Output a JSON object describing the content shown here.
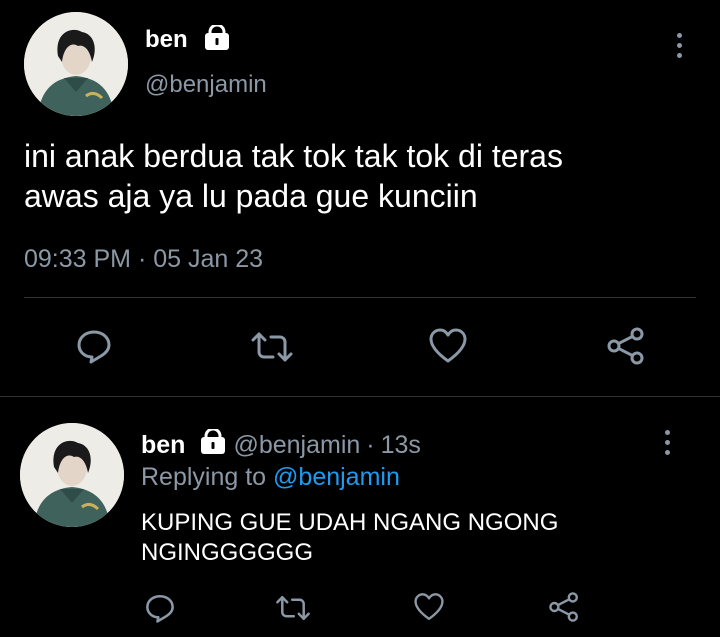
{
  "main_tweet": {
    "display_name": "ben",
    "handle": "@benjamin",
    "text_line1": "ini anak berdua tak tok tak tok di teras",
    "text_line2": "awas aja ya lu pada gue kunciin",
    "time": "09:33 PM",
    "separator": "·",
    "date": "05 Jan 23"
  },
  "reply_tweet": {
    "display_name": "ben",
    "handle": "@benjamin",
    "separator": "·",
    "age": "13s",
    "replying_prefix": "Replying to",
    "replying_handle": "@benjamin",
    "text_line1": "KUPING GUE UDAH NGANG NGONG",
    "text_line2": "NGINGGGGGG"
  },
  "icons": [
    "lock-icon",
    "more-icon",
    "reply-icon",
    "retweet-icon",
    "like-icon",
    "share-icon"
  ],
  "colors": {
    "background": "#000000",
    "text": "#ffffff",
    "muted": "#8b98a5",
    "link": "#1d9bf0",
    "divider": "#2f3336"
  }
}
